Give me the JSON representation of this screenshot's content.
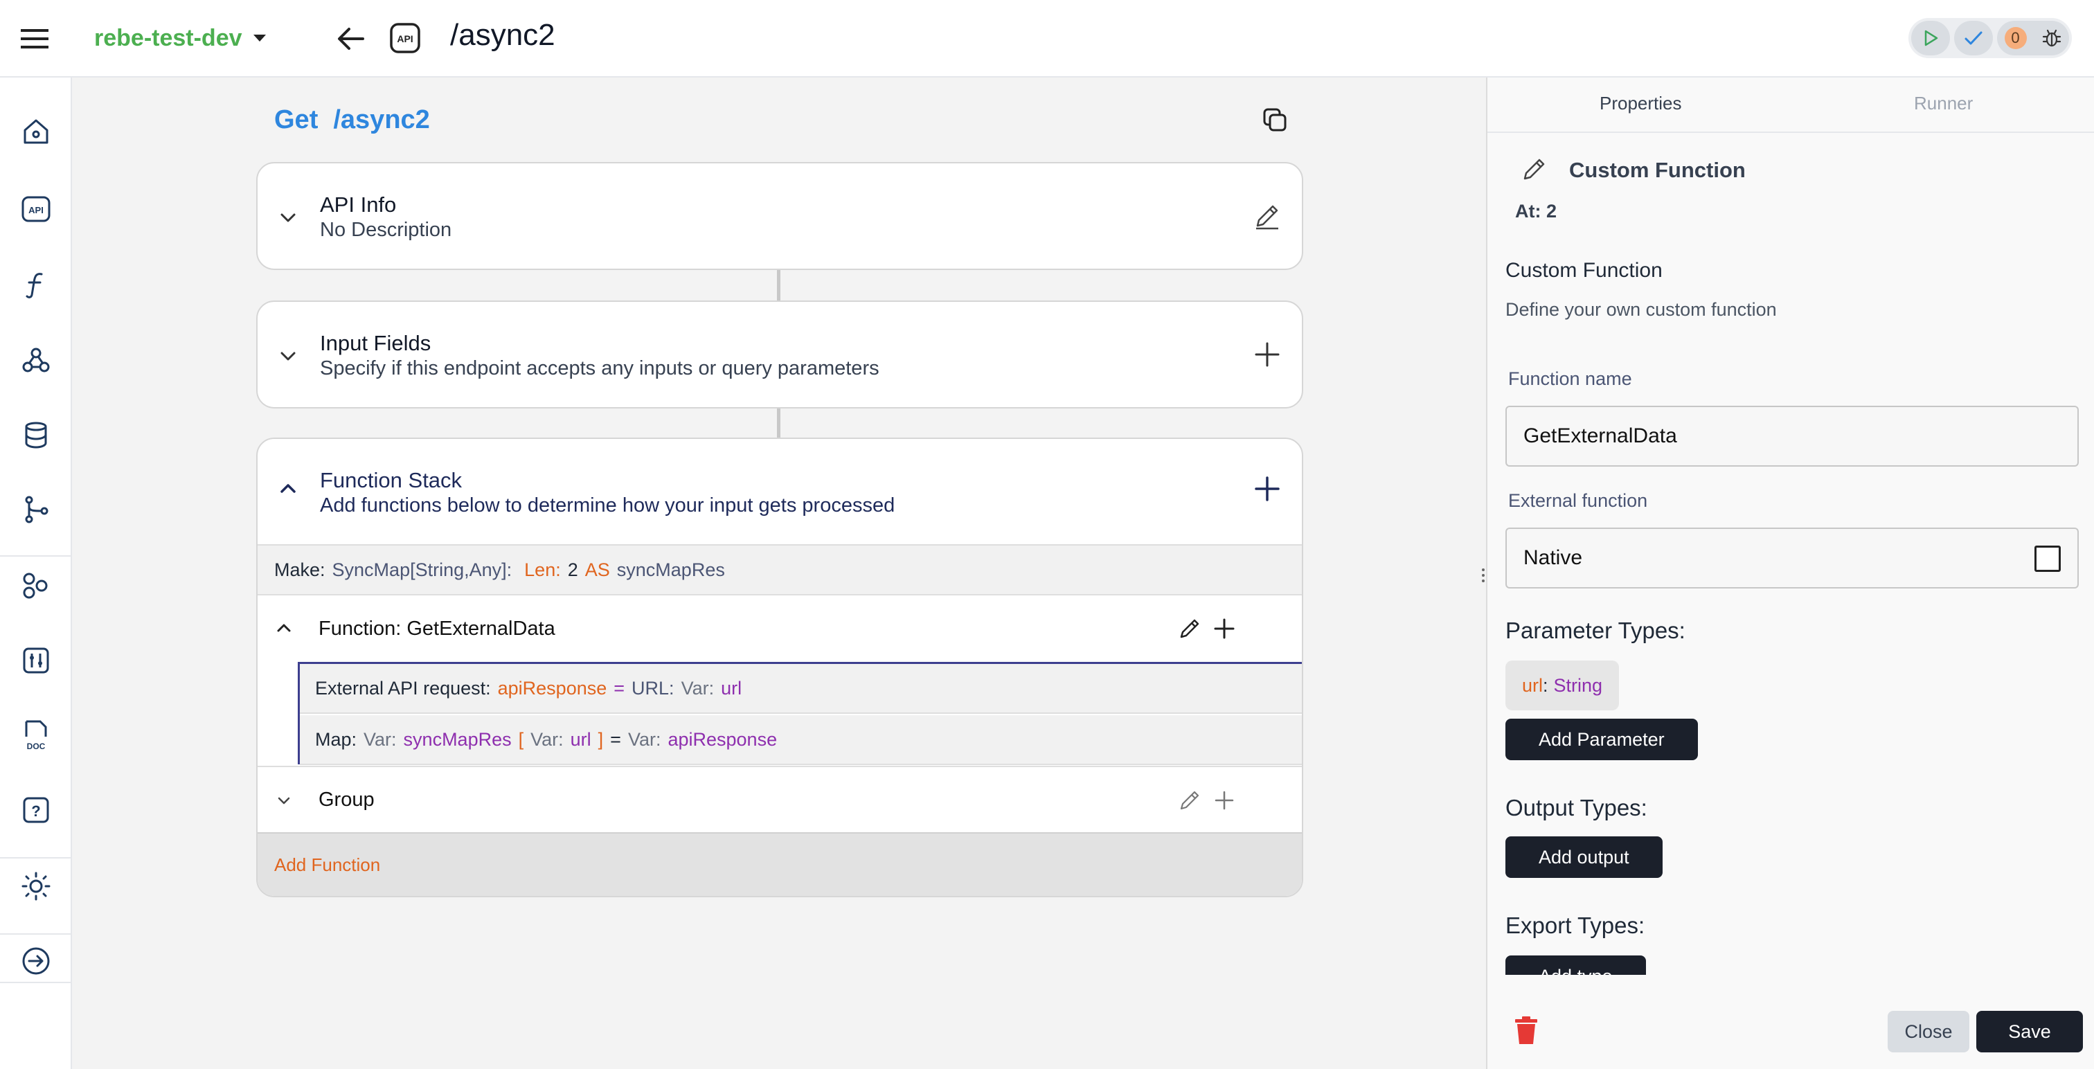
{
  "header": {
    "project": "rebe-test-dev",
    "api_badge": "API",
    "route": "/async2",
    "error_count": "0"
  },
  "rail": {
    "items": [
      "home-icon",
      "api-icon",
      "function-icon",
      "webhook-icon",
      "database-icon",
      "branch-icon",
      "shapes-icon",
      "tools-icon",
      "doc-icon",
      "help-icon",
      "theme-icon",
      "logout-icon"
    ]
  },
  "endpoint": {
    "method": "Get",
    "path": "/async2"
  },
  "api_info": {
    "title": "API Info",
    "subtitle": "No Description"
  },
  "input_fields": {
    "title": "Input Fields",
    "subtitle": "Specify if this endpoint accepts any inputs or query parameters"
  },
  "function_stack": {
    "title": "Function Stack",
    "subtitle": "Add functions below to determine how your input gets processed",
    "make_row": {
      "prefix": "Make:",
      "type": "SyncMap[String,Any]:",
      "len_label": "Len:",
      "len_value": "2",
      "as_label": "AS",
      "var_name": "syncMapRes"
    },
    "function_row": {
      "label": "Function: GetExternalData"
    },
    "sub_rows": {
      "request": {
        "prefix": "External API request:",
        "target": "apiResponse",
        "eq": "=",
        "url_label": "URL:",
        "var_label": "Var:",
        "var_name": "url"
      },
      "map": {
        "prefix": "Map:",
        "var1_label": "Var:",
        "var1_name": "syncMapRes",
        "lbracket": "[",
        "var2_label": "Var:",
        "var2_name": "url",
        "rbracket": "]",
        "eq": "=",
        "var3_label": "Var:",
        "var3_name": "apiResponse"
      }
    },
    "group_row": {
      "label": "Group"
    },
    "add_function": "Add Function"
  },
  "panel": {
    "tabs": [
      "Properties",
      "Runner"
    ],
    "header_title": "Custom Function",
    "at_label": "At: 2",
    "section_title": "Custom Function",
    "section_desc": "Define your own custom function",
    "function_name_label": "Function name",
    "function_name_value": "GetExternalData",
    "external_label": "External function",
    "external_value": "Native",
    "param_types_title": "Parameter Types:",
    "param_name": "url",
    "param_sep": ":",
    "param_type": "String",
    "add_parameter": "Add Parameter",
    "output_types_title": "Output Types:",
    "add_output": "Add output",
    "export_types_title": "Export Types:",
    "add_type": "Add type",
    "close": "Close",
    "save": "Save"
  },
  "colors": {
    "accent_blue": "#2e86de",
    "project_green": "#4caf50",
    "orange": "#e0651f",
    "purple": "#8e2fae",
    "dark_button": "#1b202b",
    "trash_red": "#e53935"
  }
}
